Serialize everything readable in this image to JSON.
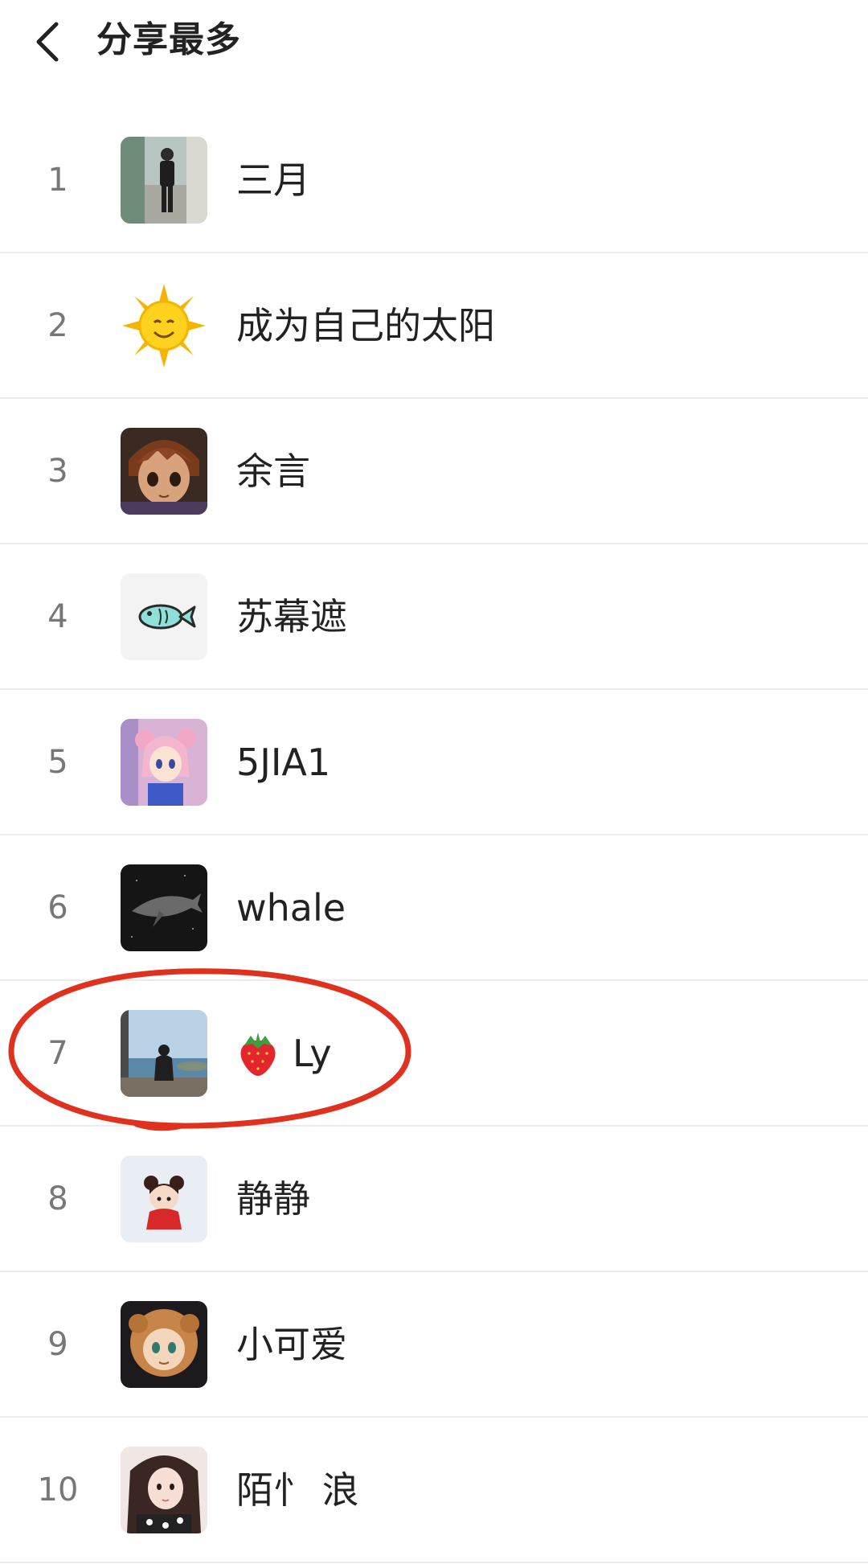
{
  "header": {
    "back_icon": "chevron-left-icon",
    "title": "分享最多"
  },
  "list": [
    {
      "rank": "1",
      "name": "三月",
      "avatar": "person-street-photo"
    },
    {
      "rank": "2",
      "name": "成为自己的太阳",
      "avatar": "smiling-sun"
    },
    {
      "rank": "3",
      "name": "余言",
      "avatar": "anime-boy"
    },
    {
      "rank": "4",
      "name": "苏幕遮",
      "avatar": "fish-doodle"
    },
    {
      "rank": "5",
      "name": "5JIA1",
      "avatar": "anime-girl-pink"
    },
    {
      "rank": "6",
      "name": "whale",
      "avatar": "whale-dark"
    },
    {
      "rank": "7",
      "name": "Ly",
      "name_prefix_icon": "strawberry-icon",
      "avatar": "girl-by-sea",
      "highlighted": true
    },
    {
      "rank": "8",
      "name": "静静",
      "avatar": "cartoon-girl-red"
    },
    {
      "rank": "9",
      "name": "小可爱",
      "avatar": "anime-lion-girl"
    },
    {
      "rank": "10",
      "name": "陌忄 浪",
      "avatar": "girl-selfie"
    }
  ],
  "colors": {
    "annotation_red": "#e0301e",
    "divider": "#ececec",
    "rank_text": "#777777"
  }
}
